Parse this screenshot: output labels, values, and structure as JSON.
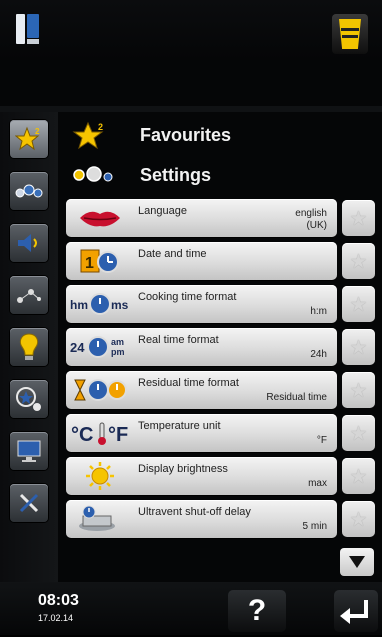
{
  "status": {
    "time": "08:03",
    "date": "17.02.14"
  },
  "sections": {
    "favourites": "Favourites",
    "settings": "Settings"
  },
  "rows": [
    {
      "label": "Language",
      "value_line1": "english",
      "value_line2": "(UK)",
      "icon": "lips-icon"
    },
    {
      "label": "Date and time",
      "value_line1": "",
      "value_line2": "",
      "icon": "calendar-clock-icon"
    },
    {
      "label": "Cooking time format",
      "value_line1": "",
      "value_line2": "h:m",
      "icon": "hm-ms-clock-icon"
    },
    {
      "label": "Real time format",
      "value_line1": "",
      "value_line2": "24h",
      "icon": "24-am-pm-clock-icon"
    },
    {
      "label": "Residual time format",
      "value_line1": "",
      "value_line2": "Residual time",
      "icon": "hourglass-clock-icon"
    },
    {
      "label": "Temperature unit",
      "value_line1": "",
      "value_line2": "°F",
      "icon": "celsius-fahrenheit-icon"
    },
    {
      "label": "Display brightness",
      "value_line1": "",
      "value_line2": "max",
      "icon": "sun-icon"
    },
    {
      "label": "Ultravent shut-off delay",
      "value_line1": "",
      "value_line2": "5 min",
      "icon": "ultravent-icon"
    }
  ],
  "help_label": "?",
  "icons": {
    "sidebar": [
      "favourites-star-icon",
      "settings-dots-icon",
      "speaker-icon",
      "network-icon",
      "info-bulb-icon",
      "star-search-icon",
      "monitor-icon",
      "tools-icon"
    ]
  },
  "colors": {
    "accent": "#f2c400",
    "text_dark": "#222222",
    "row_bg": "#dcdcdc"
  }
}
